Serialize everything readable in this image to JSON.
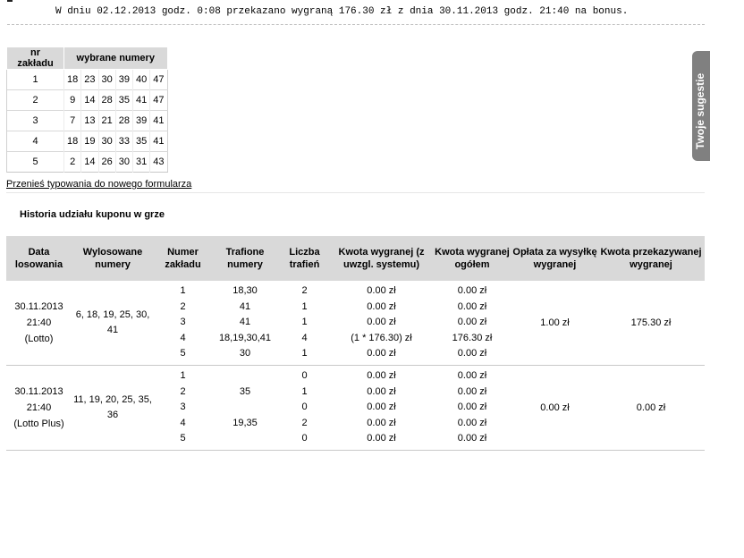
{
  "notice": "W dniu 02.12.2013 godz. 0:08 przekazano wygraną 176.30 zł z dnia 30.11.2013 godz. 21:40 na bonus.",
  "bets_table": {
    "headers": [
      "nr zakładu",
      "wybrane numery"
    ],
    "rows": [
      {
        "nr": "1",
        "numbers": [
          "18",
          "23",
          "30",
          "39",
          "40",
          "47"
        ]
      },
      {
        "nr": "2",
        "numbers": [
          "9",
          "14",
          "28",
          "35",
          "41",
          "47"
        ]
      },
      {
        "nr": "3",
        "numbers": [
          "7",
          "13",
          "21",
          "28",
          "39",
          "41"
        ]
      },
      {
        "nr": "4",
        "numbers": [
          "18",
          "19",
          "30",
          "33",
          "35",
          "41"
        ]
      },
      {
        "nr": "5",
        "numbers": [
          "2",
          "14",
          "26",
          "30",
          "31",
          "43"
        ]
      }
    ]
  },
  "transfer_link": "Przenieś typowania do nowego formularza",
  "section_title": "Historia udziału kuponu w grze",
  "history": {
    "headers": [
      "Data losowania",
      "Wylosowane numery",
      "Numer zakładu",
      "Trafione numery",
      "Liczba trafień",
      "Kwota wygranej (z uwzgl. systemu)",
      "Kwota wygranej ogółem",
      "Opłata za wysyłkę wygranej",
      "Kwota przekazywanej wygranej"
    ],
    "draws": [
      {
        "date": "30.11.2013",
        "time": "21:40",
        "game": "(Lotto)",
        "drawn": "6, 18, 19, 25, 30, 41",
        "bets": [
          "1",
          "2",
          "3",
          "4",
          "5"
        ],
        "hit_numbers": [
          "18,30",
          "41",
          "41",
          "18,19,30,41",
          "30"
        ],
        "hit_counts": [
          "2",
          "1",
          "1",
          "4",
          "1"
        ],
        "win_amounts": [
          "0.00 zł",
          "0.00 zł",
          "0.00 zł",
          "(1 * 176.30) zł",
          "0.00 zł"
        ],
        "win_totals": [
          "0.00 zł",
          "0.00 zł",
          "0.00 zł",
          "176.30 zł",
          "0.00 zł"
        ],
        "fee": "1.00 zł",
        "transferred": "175.30 zł"
      },
      {
        "date": "30.11.2013",
        "time": "21:40",
        "game": "(Lotto Plus)",
        "drawn": "11, 19, 20, 25, 35, 36",
        "bets": [
          "1",
          "2",
          "3",
          "4",
          "5"
        ],
        "hit_numbers": [
          "",
          "35",
          "",
          "19,35",
          ""
        ],
        "hit_counts": [
          "0",
          "1",
          "0",
          "2",
          "0"
        ],
        "win_amounts": [
          "0.00 zł",
          "0.00 zł",
          "0.00 zł",
          "0.00 zł",
          "0.00 zł"
        ],
        "win_totals": [
          "0.00 zł",
          "0.00 zł",
          "0.00 zł",
          "0.00 zł",
          "0.00 zł"
        ],
        "fee": "0.00 zł",
        "transferred": "0.00 zł"
      }
    ]
  },
  "side_tab": "Twoje sugestie",
  "colors": {
    "header_bg": "#d9d9d9",
    "side_tab_bg": "#808080",
    "side_tab_dot": "#7ec850"
  }
}
